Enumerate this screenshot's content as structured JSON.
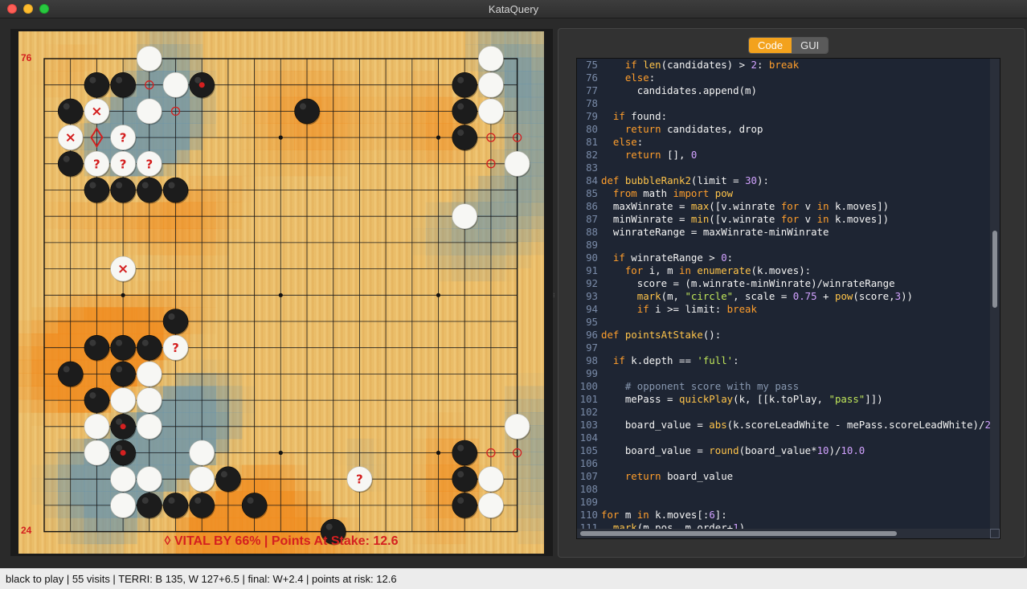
{
  "window": {
    "title": "KataQuery",
    "controls": [
      "close",
      "minimize",
      "zoom"
    ]
  },
  "board": {
    "size": 19,
    "move_number_top": "76",
    "move_number_bottom": "24",
    "vital_text": "◊ VITAL BY 66% | Points At Stake: 12.6",
    "black_stones": [
      [
        2,
        1
      ],
      [
        3,
        1
      ],
      [
        6,
        1
      ],
      [
        1,
        2
      ],
      [
        10,
        2
      ],
      [
        16,
        1
      ],
      [
        16,
        2
      ],
      [
        16,
        3
      ],
      [
        1,
        4
      ],
      [
        2,
        5
      ],
      [
        3,
        5
      ],
      [
        4,
        5
      ],
      [
        5,
        5
      ],
      [
        5,
        10
      ],
      [
        2,
        11
      ],
      [
        3,
        11
      ],
      [
        4,
        11
      ],
      [
        1,
        12
      ],
      [
        3,
        12
      ],
      [
        2,
        13
      ],
      [
        3,
        14
      ],
      [
        3,
        15
      ],
      [
        7,
        16
      ],
      [
        4,
        17
      ],
      [
        5,
        17
      ],
      [
        6,
        17
      ],
      [
        8,
        17
      ],
      [
        16,
        15
      ],
      [
        16,
        16
      ],
      [
        16,
        17
      ],
      [
        11,
        18
      ]
    ],
    "white_stones": [
      [
        4,
        0
      ],
      [
        17,
        0
      ],
      [
        5,
        1
      ],
      [
        17,
        1
      ],
      [
        2,
        2
      ],
      [
        4,
        2
      ],
      [
        17,
        2
      ],
      [
        1,
        3
      ],
      [
        3,
        3
      ],
      [
        2,
        4
      ],
      [
        3,
        4
      ],
      [
        4,
        4
      ],
      [
        18,
        4
      ],
      [
        16,
        6
      ],
      [
        3,
        8
      ],
      [
        5,
        11
      ],
      [
        4,
        12
      ],
      [
        3,
        13
      ],
      [
        4,
        13
      ],
      [
        2,
        14
      ],
      [
        4,
        14
      ],
      [
        18,
        14
      ],
      [
        2,
        15
      ],
      [
        6,
        15
      ],
      [
        3,
        16
      ],
      [
        4,
        16
      ],
      [
        6,
        16
      ],
      [
        12,
        16
      ],
      [
        17,
        16
      ],
      [
        3,
        17
      ],
      [
        17,
        17
      ]
    ],
    "stone_marks": [
      {
        "pos": [
          6,
          1
        ],
        "mark": "dot"
      },
      {
        "pos": [
          2,
          2
        ],
        "mark": "×"
      },
      {
        "pos": [
          1,
          3
        ],
        "mark": "×"
      },
      {
        "pos": [
          3,
          3
        ],
        "mark": "?"
      },
      {
        "pos": [
          2,
          4
        ],
        "mark": "?"
      },
      {
        "pos": [
          3,
          4
        ],
        "mark": "?"
      },
      {
        "pos": [
          4,
          4
        ],
        "mark": "?"
      },
      {
        "pos": [
          3,
          8
        ],
        "mark": "×"
      },
      {
        "pos": [
          5,
          11
        ],
        "mark": "?"
      },
      {
        "pos": [
          3,
          14
        ],
        "mark": "dot"
      },
      {
        "pos": [
          3,
          15
        ],
        "mark": "dot"
      },
      {
        "pos": [
          12,
          16
        ],
        "mark": "?"
      }
    ],
    "empty_circles": [
      [
        4,
        1
      ],
      [
        5,
        2
      ],
      [
        17,
        3
      ],
      [
        18,
        3
      ],
      [
        17,
        4
      ],
      [
        17,
        15
      ],
      [
        18,
        15
      ]
    ],
    "vital_point": [
      2,
      3
    ],
    "star_points": [
      [
        3,
        3
      ],
      [
        9,
        3
      ],
      [
        15,
        3
      ],
      [
        3,
        9
      ],
      [
        9,
        9
      ],
      [
        15,
        9
      ],
      [
        3,
        15
      ],
      [
        9,
        15
      ],
      [
        15,
        15
      ]
    ],
    "colors": {
      "white_territory": "#6e95a8",
      "black_territory": "#f08a1c",
      "mark_red": "#d42020"
    }
  },
  "tabs": [
    {
      "label": "Code",
      "active": true
    },
    {
      "label": "GUI",
      "active": false
    }
  ],
  "code": {
    "lines": [
      {
        "num": "75",
        "text": "    if len(candidates) > 2: break"
      },
      {
        "num": "76",
        "text": "    else:"
      },
      {
        "num": "77",
        "text": "      candidates.append(m)"
      },
      {
        "num": "78",
        "text": ""
      },
      {
        "num": "79",
        "text": "  if found:"
      },
      {
        "num": "80",
        "text": "    return candidates, drop"
      },
      {
        "num": "81",
        "text": "  else:"
      },
      {
        "num": "82",
        "text": "    return [], 0"
      },
      {
        "num": "83",
        "text": ""
      },
      {
        "num": "84",
        "text": "def bubbleRank2(limit = 30):"
      },
      {
        "num": "85",
        "text": "  from math import pow"
      },
      {
        "num": "86",
        "text": "  maxWinrate = max([v.winrate for v in k.moves])"
      },
      {
        "num": "87",
        "text": "  minWinrate = min([v.winrate for v in k.moves])"
      },
      {
        "num": "88",
        "text": "  winrateRange = maxWinrate-minWinrate"
      },
      {
        "num": "89",
        "text": ""
      },
      {
        "num": "90",
        "text": "  if winrateRange > 0:"
      },
      {
        "num": "91",
        "text": "    for i, m in enumerate(k.moves):"
      },
      {
        "num": "92",
        "text": "      score = (m.winrate-minWinrate)/winrateRange"
      },
      {
        "num": "93",
        "text": "      mark(m, \"circle\", scale = 0.75 + pow(score,3))"
      },
      {
        "num": "94",
        "text": "      if i >= limit: break"
      },
      {
        "num": "95",
        "text": ""
      },
      {
        "num": "96",
        "text": "def pointsAtStake():"
      },
      {
        "num": "97",
        "text": ""
      },
      {
        "num": "98",
        "text": "  if k.depth == 'full':"
      },
      {
        "num": "99",
        "text": ""
      },
      {
        "num": "100",
        "text": "    # opponent score with my pass"
      },
      {
        "num": "101",
        "text": "    mePass = quickPlay(k, [[k.toPlay, \"pass\"]])"
      },
      {
        "num": "102",
        "text": ""
      },
      {
        "num": "103",
        "text": "    board_value = abs(k.scoreLeadWhite - mePass.scoreLeadWhite)/2"
      },
      {
        "num": "104",
        "text": ""
      },
      {
        "num": "105",
        "text": "    board_value = round(board_value*10)/10.0"
      },
      {
        "num": "106",
        "text": ""
      },
      {
        "num": "107",
        "text": "    return board_value"
      },
      {
        "num": "108",
        "text": ""
      },
      {
        "num": "109",
        "text": ""
      },
      {
        "num": "110",
        "text": "for m in k.moves[:6]:"
      },
      {
        "num": "111",
        "text": "  mark(m.pos, m.order+1)"
      }
    ]
  },
  "status": {
    "text": "black to play | 55 visits | TERRI: B 135, W 127+6.5 | final: W+2.4 | points at risk: 12.6"
  }
}
